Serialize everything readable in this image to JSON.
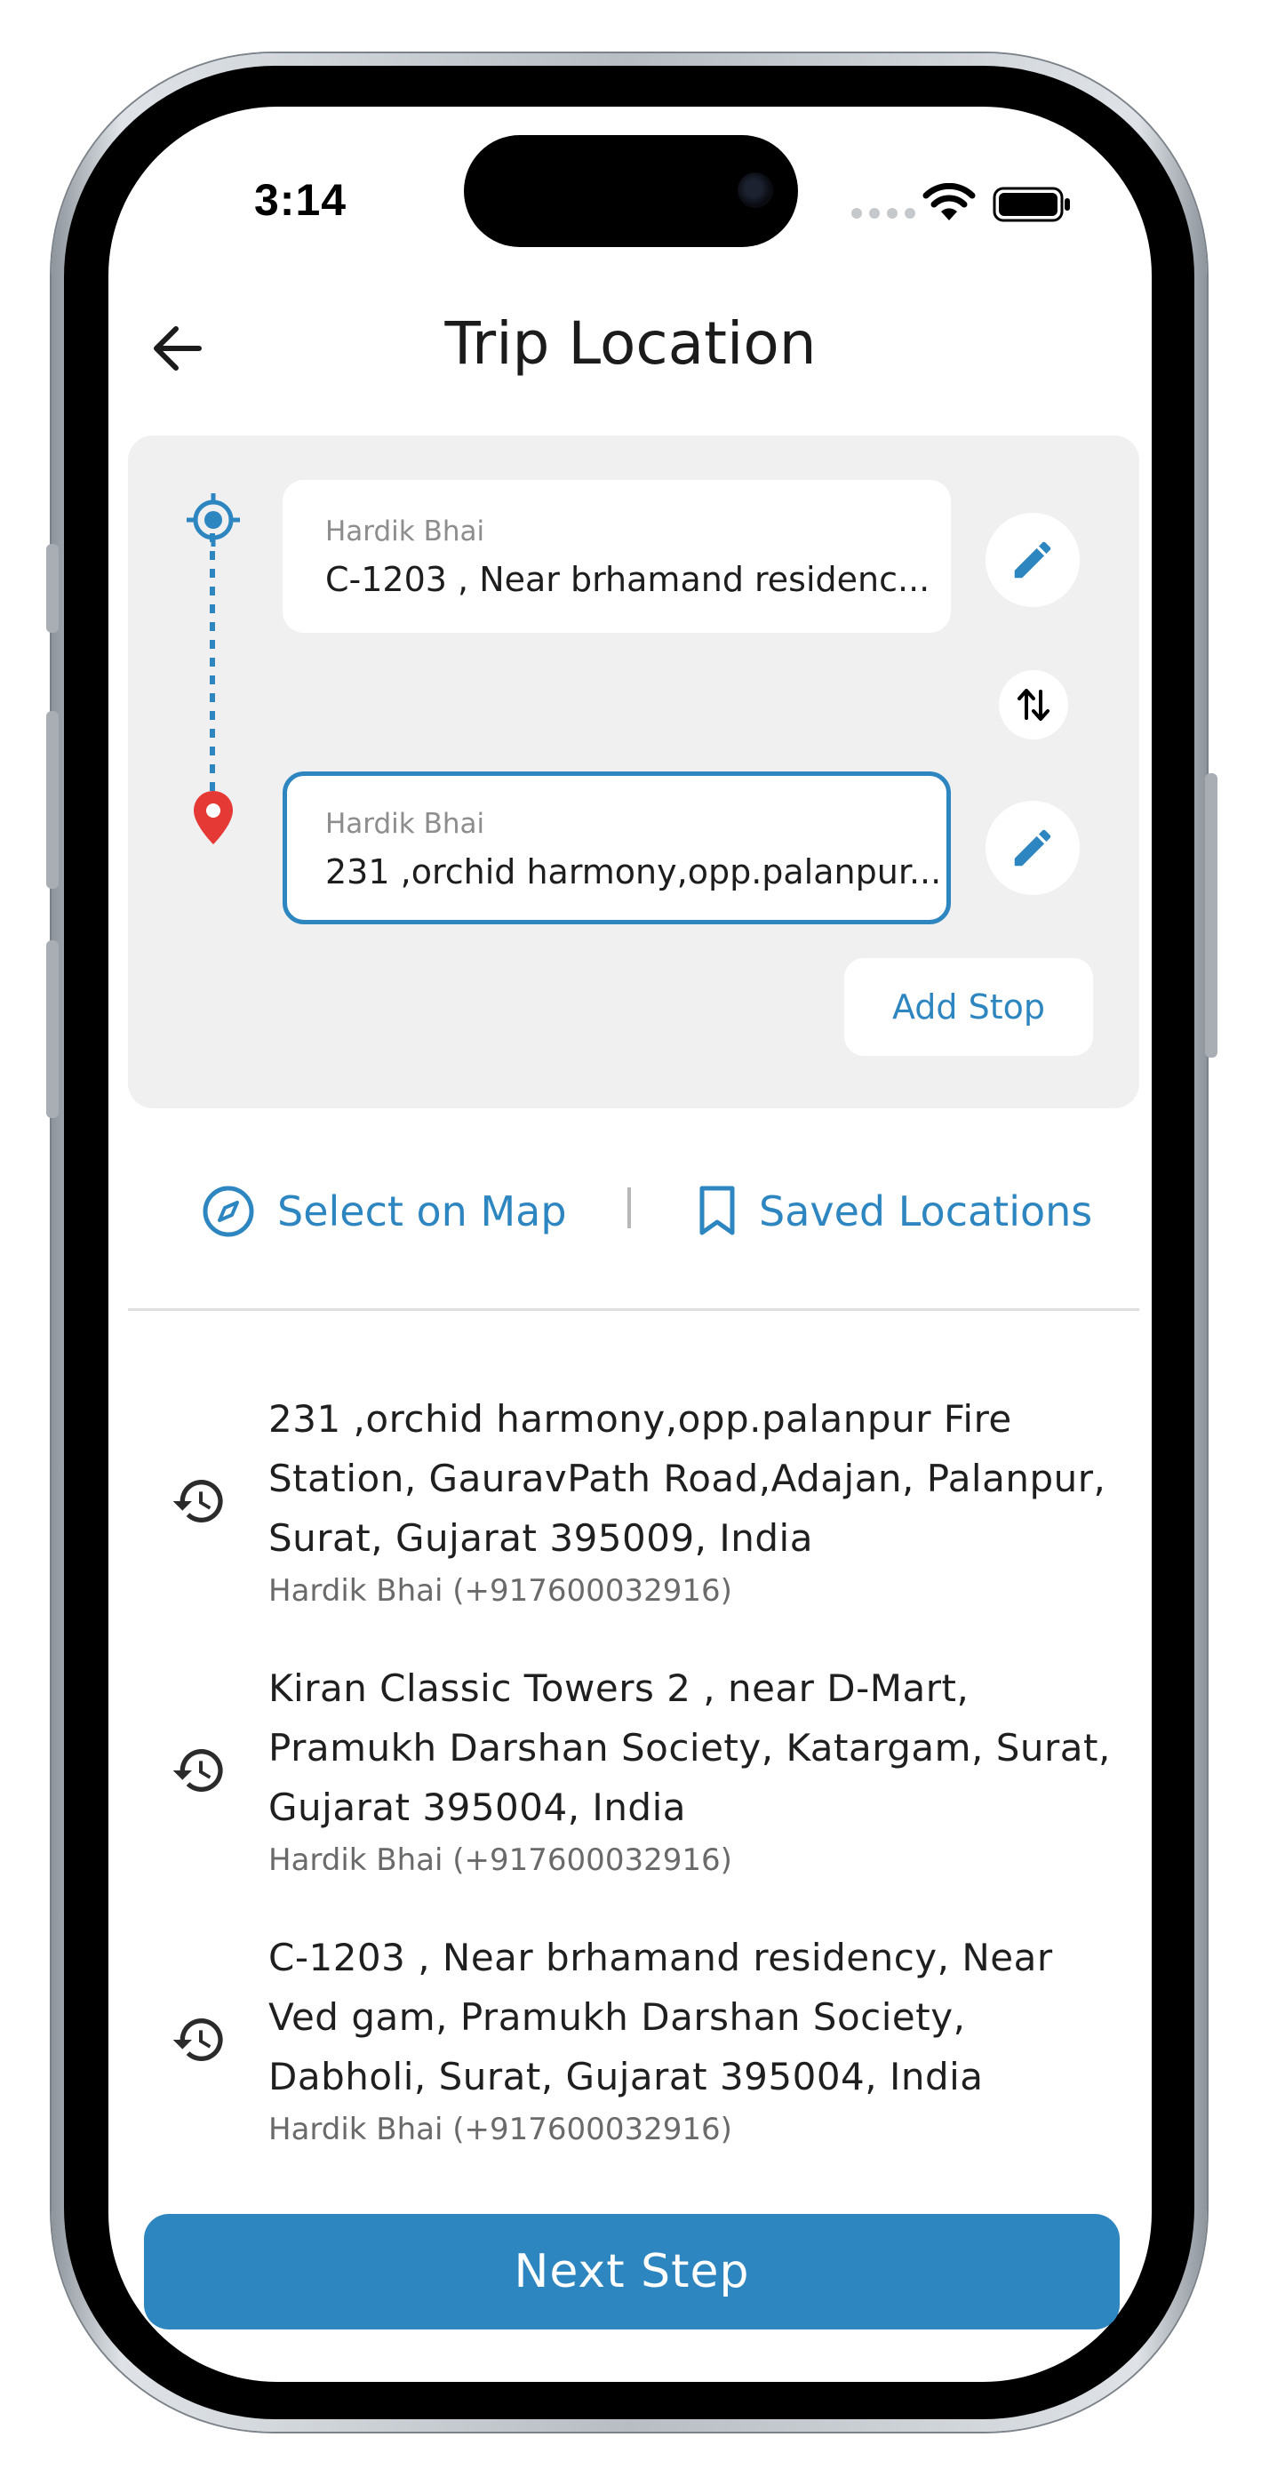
{
  "status_bar": {
    "time": "3:14"
  },
  "header": {
    "title": "Trip Location"
  },
  "route": {
    "pickup": {
      "name": "Hardik Bhai",
      "address": "C-1203 , Near brhamand residenc..."
    },
    "dropoff": {
      "name": "Hardik Bhai",
      "address": "231 ,orchid harmony,opp.palanpur..."
    },
    "add_stop_label": "Add Stop"
  },
  "actions": {
    "select_on_map": "Select on Map",
    "separator": "|",
    "saved_locations": "Saved Locations"
  },
  "history": [
    {
      "address": "231 ,orchid harmony,opp.palanpur Fire Station, GauravPath Road,Adajan, Palanpur, Surat, Gujarat 395009, India",
      "contact": "Hardik Bhai (+917600032916)"
    },
    {
      "address": "Kiran Classic Towers 2 , near D-Mart, Pramukh Darshan Society, Katargam, Surat, Gujarat 395004, India",
      "contact": "Hardik Bhai (+917600032916)"
    },
    {
      "address": "C-1203 , Near brhamand residency, Near Ved gam, Pramukh Darshan Society, Dabholi, Surat, Gujarat 395004, India",
      "contact": "Hardik Bhai (+917600032916)"
    }
  ],
  "footer": {
    "next_label": "Next Step"
  },
  "colors": {
    "accent": "#2e86c1",
    "pin_red": "#e53935",
    "card_bg": "#f0f0f0"
  },
  "icons": {
    "back": "arrow-left-icon",
    "pickup": "my-location-icon",
    "dropoff": "location-pin-icon",
    "edit": "pencil-icon",
    "swap": "swap-vertical-icon",
    "map": "compass-icon",
    "saved": "bookmark-icon",
    "history": "history-icon"
  }
}
